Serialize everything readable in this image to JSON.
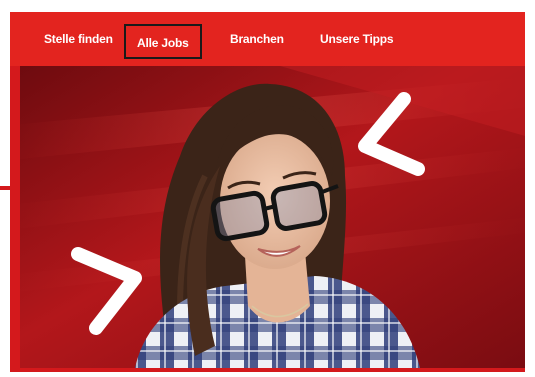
{
  "nav": {
    "items": [
      {
        "label": "Stelle finden",
        "active": false
      },
      {
        "label": "Alle Jobs",
        "active": true
      },
      {
        "label": "Branchen",
        "active": false
      },
      {
        "label": "Unsere Tipps",
        "active": false
      }
    ]
  },
  "hero": {
    "left_chevron_icon": "chevron-right-icon",
    "right_chevron_icon": "chevron-left-icon"
  },
  "colors": {
    "brand_red": "#e3241f",
    "hero_dark_red": "#8f0f14",
    "active_border": "#1a1a1a"
  }
}
